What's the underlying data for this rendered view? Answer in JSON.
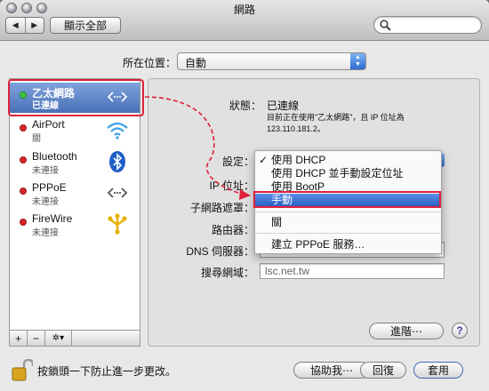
{
  "window": {
    "title": "網路"
  },
  "toolbar": {
    "show_all_label": "顯示全部",
    "back_arrow": "◀",
    "forward_arrow": "▶"
  },
  "search": {
    "icon": "search-icon",
    "value": ""
  },
  "location": {
    "label": "所在位置：",
    "value": "自動"
  },
  "services": [
    {
      "name": "乙太網路",
      "status": "已連線",
      "indicator": "#3cc43c",
      "icon": "ethernet-icon",
      "selected": true
    },
    {
      "name": "AirPort",
      "status": "關",
      "indicator": "#d8232a",
      "icon": "wifi-icon",
      "selected": false
    },
    {
      "name": "Bluetooth",
      "status": "未連接",
      "indicator": "#d8232a",
      "icon": "bluetooth-icon",
      "selected": false
    },
    {
      "name": "PPPoE",
      "status": "未連接",
      "indicator": "#d8232a",
      "icon": "pppoe-icon",
      "selected": false
    },
    {
      "name": "FireWire",
      "status": "未連接",
      "indicator": "#d8232a",
      "icon": "firewire-icon",
      "selected": false
    }
  ],
  "sidebar_tools": {
    "add": "+",
    "remove": "−",
    "action": "✲▾"
  },
  "details": {
    "status_label": "狀態：",
    "status_value": "已連線",
    "status_note_line1": "目前正在使用\"乙太網路\"，且 IP 位址為",
    "status_note_line2": "123.110.181.2。",
    "config_label": "設定：",
    "ip_label": "IP 位址：",
    "subnet_label": "子網路遮罩：",
    "router_label": "路由器：",
    "dns_label": "DNS 伺服器：",
    "search_domain_label": "搜尋網域：",
    "search_domain_value": "lsc.net.tw"
  },
  "config_menu": {
    "items": [
      {
        "label": "使用 DHCP",
        "checked": true
      },
      {
        "label": "使用 DHCP 並手動設定位址",
        "checked": false
      },
      {
        "label": "使用 BootP",
        "checked": false
      },
      {
        "label": "手動",
        "highlighted": true
      },
      {
        "label": "關",
        "checked": false
      },
      {
        "label": "建立 PPPoE 服務…",
        "checked": false
      }
    ],
    "check_mark": "✓"
  },
  "buttons": {
    "advanced": "進階⋯",
    "help": "?",
    "assist": "協助我⋯",
    "revert": "回復",
    "apply": "套用"
  },
  "lock": {
    "text": "按鎖頭一下防止進一步更改。",
    "icon": "lock-icon"
  },
  "colors": {
    "selection": "#4a72b8",
    "highlight_border": "#e0203a",
    "arrow": "#e0203a"
  }
}
